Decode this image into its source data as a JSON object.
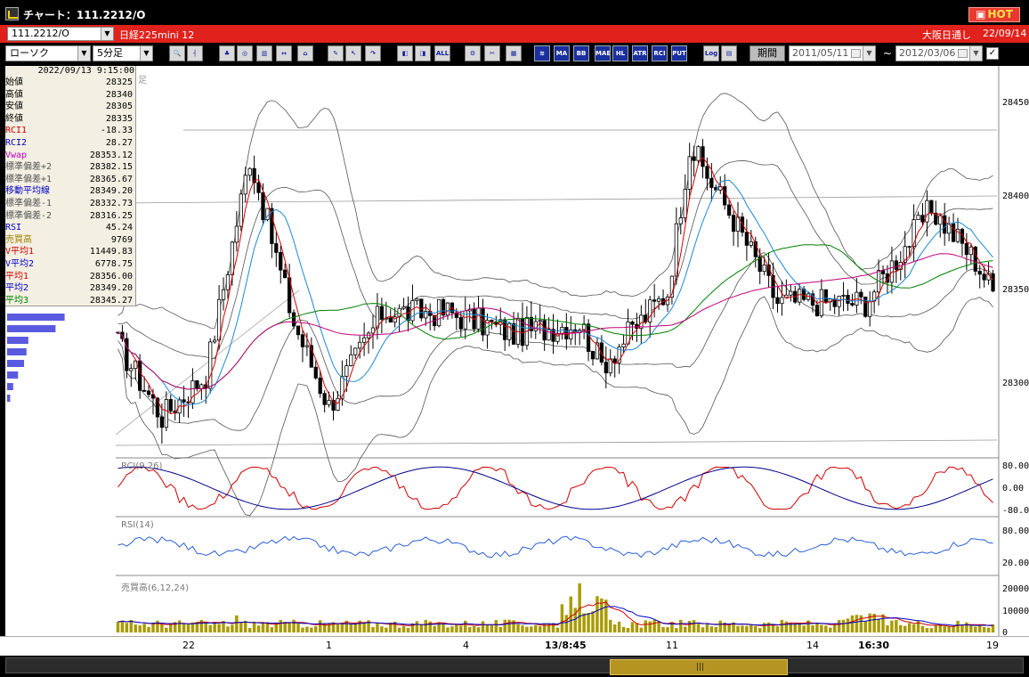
{
  "window": {
    "title": "チャート：111.2212/O",
    "hot": "HOT"
  },
  "symbol": {
    "code": "111.2212/O",
    "name": "日経225mini 12",
    "market": "大阪日通し",
    "date": "22/09/14"
  },
  "toolbar": {
    "chart_type": "ローソク",
    "interval": "5分足",
    "period_label": "期間",
    "from": "2011/05/11",
    "to": "2012/03/06",
    "sep": "~",
    "check": "✓",
    "buttons": [
      {
        "id": "zoom",
        "t": "🔍"
      },
      {
        "id": "cursor",
        "t": "┤"
      },
      {
        "id": "b1",
        "t": "♣"
      },
      {
        "id": "b2",
        "t": "◎"
      },
      {
        "id": "b3",
        "t": "▥"
      },
      {
        "id": "b4",
        "t": "↔"
      },
      {
        "id": "b5",
        "t": "⌂"
      },
      {
        "id": "b6",
        "t": "✎"
      },
      {
        "id": "b7",
        "t": "↖"
      },
      {
        "id": "b8",
        "t": "↷"
      },
      {
        "id": "b9",
        "t": "◧"
      },
      {
        "id": "b10",
        "t": "◨"
      },
      {
        "id": "all",
        "t": "ALL"
      },
      {
        "id": "b12",
        "t": "⚙"
      },
      {
        "id": "b13",
        "t": "✂"
      },
      {
        "id": "b14",
        "t": "▦"
      },
      {
        "id": "ind",
        "t": "≋"
      },
      {
        "id": "ma",
        "t": "MA"
      },
      {
        "id": "bb",
        "t": "BB"
      },
      {
        "id": "mae",
        "t": "MAE"
      },
      {
        "id": "hl",
        "t": "HL"
      },
      {
        "id": "atr",
        "t": "ATR"
      },
      {
        "id": "rsi",
        "t": "RCI"
      },
      {
        "id": "put",
        "t": "PUT"
      },
      {
        "id": "log",
        "t": "Log"
      },
      {
        "id": "b26",
        "t": "▤"
      }
    ]
  },
  "info": {
    "datetime": "2022/09/13 9:15:00",
    "rows": [
      {
        "l": "始値",
        "v": "28325",
        "c": "#000"
      },
      {
        "l": "高値",
        "v": "28340",
        "c": "#000"
      },
      {
        "l": "安値",
        "v": "28305",
        "c": "#000"
      },
      {
        "l": "終値",
        "v": "28335",
        "c": "#000"
      },
      {
        "l": "RCI1",
        "v": "-18.33",
        "c": "#d00000"
      },
      {
        "l": "RCI2",
        "v": "28.27",
        "c": "#0000c8"
      },
      {
        "l": "Vwap",
        "v": "28353.12",
        "c": "#c000c0"
      },
      {
        "l": "標準偏差+2",
        "v": "28382.15",
        "c": "#555"
      },
      {
        "l": "標準偏差+1",
        "v": "28365.67",
        "c": "#555"
      },
      {
        "l": "移動平均線",
        "v": "28349.20",
        "c": "#0000c8"
      },
      {
        "l": "標準偏差-1",
        "v": "28332.73",
        "c": "#555"
      },
      {
        "l": "標準偏差-2",
        "v": "28316.25",
        "c": "#555"
      },
      {
        "l": "RSI",
        "v": "45.24",
        "c": "#0000c8"
      },
      {
        "l": "売買高",
        "v": "9769",
        "c": "#a08000"
      },
      {
        "l": "V平均1",
        "v": "11449.83",
        "c": "#d00000"
      },
      {
        "l": "V平均2",
        "v": "6778.75",
        "c": "#0000c8"
      },
      {
        "l": "平均1",
        "v": "28356.00",
        "c": "#d00000"
      },
      {
        "l": "平均2",
        "v": "28349.20",
        "c": "#0000c8"
      },
      {
        "l": "平均3",
        "v": "28345.27",
        "c": "#008000"
      }
    ]
  },
  "panels": {
    "main_label": "足",
    "rci_label": "RCI(9,26)",
    "rsi_label": "RSI(14)",
    "vol_label": "売買高(6,12,24)"
  },
  "price_axis": {
    "labels": [
      "28450",
      "28400",
      "28350",
      "28300"
    ]
  },
  "rci_axis": {
    "labels": [
      "80.00",
      "0.00",
      "-80.00"
    ]
  },
  "rsi_axis": {
    "labels": [
      "80.00",
      "20.00"
    ]
  },
  "vol_axis": {
    "labels": [
      "20000",
      "10000",
      "0"
    ]
  },
  "x_axis": {
    "labels": [
      {
        "t": "22",
        "b": false
      },
      {
        "t": "1",
        "b": false
      },
      {
        "t": "4",
        "b": false
      },
      {
        "t": "13/8:45",
        "b": true
      },
      {
        "t": "11",
        "b": false
      },
      {
        "t": "14",
        "b": false
      },
      {
        "t": "16:30",
        "b": true
      },
      {
        "t": "19",
        "b": false
      }
    ]
  },
  "scroll": {
    "grip": "|||"
  },
  "colors": {
    "candle": "#000000",
    "ma_short": "#d00000",
    "ma_mid": "#1b88d8",
    "ma_long": "#008000",
    "vwap": "#c0007a",
    "band": "#555555",
    "volume": "#a89b00",
    "rci_fast": "#d00000",
    "rci_slow": "#00008c",
    "rsi": "#2a5fd8",
    "profile": "#5a5ae0"
  },
  "chart_data": {
    "type": "candlestick",
    "seed": 17,
    "price_range": [
      28280,
      28460
    ],
    "candle_count": 200,
    "closes_start": 28335,
    "closes_end": 28360,
    "volume_max": 25000,
    "volume_spike": 23000,
    "profile_bars": [
      0.95,
      0.8,
      0.35,
      0.32,
      0.28,
      0.18,
      0.1,
      0.05
    ]
  }
}
